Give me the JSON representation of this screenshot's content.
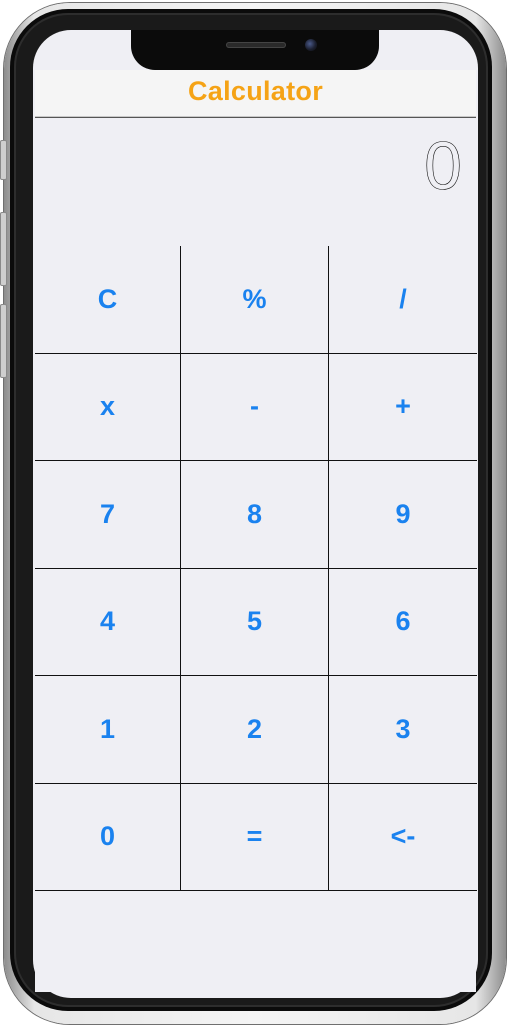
{
  "app": {
    "title": "Calculator"
  },
  "display": {
    "value": "0"
  },
  "keypad": {
    "keys": [
      {
        "label": "C",
        "name": "clear-button"
      },
      {
        "label": "%",
        "name": "percent-button"
      },
      {
        "label": "/",
        "name": "divide-button"
      },
      {
        "label": "x",
        "name": "multiply-button"
      },
      {
        "label": "-",
        "name": "subtract-button"
      },
      {
        "label": "+",
        "name": "add-button"
      },
      {
        "label": "7",
        "name": "digit-7-button"
      },
      {
        "label": "8",
        "name": "digit-8-button"
      },
      {
        "label": "9",
        "name": "digit-9-button"
      },
      {
        "label": "4",
        "name": "digit-4-button"
      },
      {
        "label": "5",
        "name": "digit-5-button"
      },
      {
        "label": "6",
        "name": "digit-6-button"
      },
      {
        "label": "1",
        "name": "digit-1-button"
      },
      {
        "label": "2",
        "name": "digit-2-button"
      },
      {
        "label": "3",
        "name": "digit-3-button"
      },
      {
        "label": "0",
        "name": "digit-0-button"
      },
      {
        "label": "=",
        "name": "equals-button"
      },
      {
        "label": "<-",
        "name": "backspace-button"
      }
    ]
  },
  "colors": {
    "title": "#f5a316",
    "key_text": "#1a82ef",
    "background": "#efeff4"
  }
}
